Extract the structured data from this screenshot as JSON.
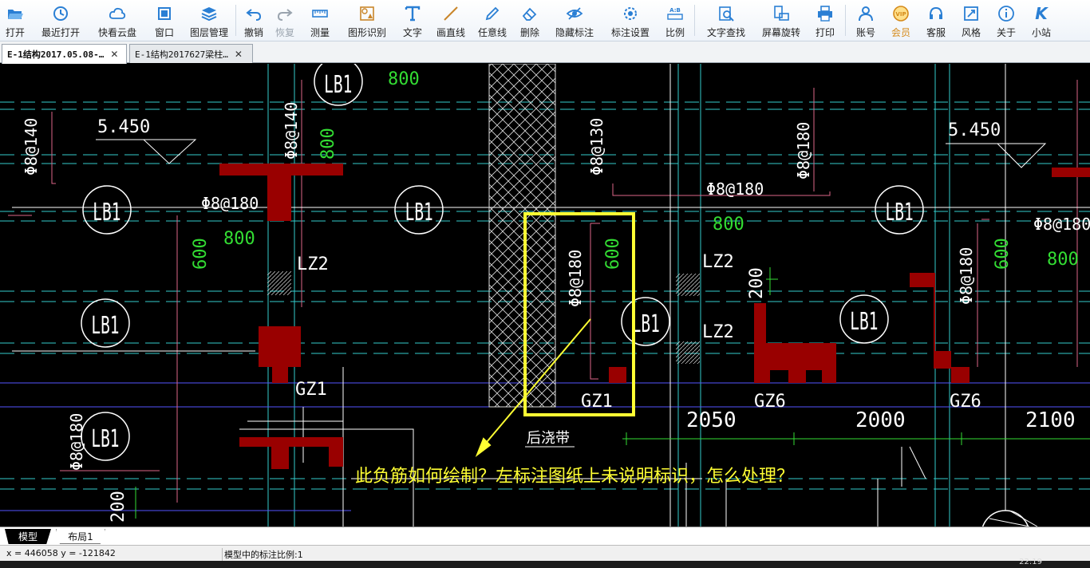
{
  "toolbar": {
    "groups": [
      [
        {
          "label": "打开",
          "icon": "folder-open-icon",
          "color": "#2a7fd4"
        },
        {
          "label": "最近打开",
          "icon": "history-icon",
          "color": "#2a7fd4"
        },
        {
          "label": "快看云盘",
          "icon": "cloud-icon",
          "color": "#2a7fd4"
        },
        {
          "label": "窗口",
          "icon": "window-icon",
          "color": "#2a7fd4"
        },
        {
          "label": "图层管理",
          "icon": "layers-icon",
          "color": "#2a7fd4"
        }
      ],
      [
        {
          "label": "撤销",
          "icon": "undo-icon",
          "color": "#2a7fd4"
        },
        {
          "label": "恢复",
          "icon": "redo-icon",
          "color": "#9aa4ae",
          "disabled": true
        },
        {
          "label": "测量",
          "icon": "ruler-icon",
          "color": "#2a7fd4"
        },
        {
          "label": "图形识别",
          "icon": "shape-recognize-icon",
          "color": "#c9862a"
        },
        {
          "label": "文字",
          "icon": "text-icon",
          "color": "#2a7fd4"
        },
        {
          "label": "画直线",
          "icon": "line-icon",
          "color": "#c9862a"
        },
        {
          "label": "任意线",
          "icon": "pen-icon",
          "color": "#2a7fd4"
        },
        {
          "label": "删除",
          "icon": "eraser-icon",
          "color": "#2a7fd4"
        },
        {
          "label": "隐藏标注",
          "icon": "eye-hide-icon",
          "color": "#2a7fd4"
        },
        {
          "label": "标注设置",
          "icon": "annotation-settings-icon",
          "color": "#2a7fd4"
        },
        {
          "label": "比例",
          "icon": "scale-icon",
          "color": "#2a7fd4"
        }
      ],
      [
        {
          "label": "文字查找",
          "icon": "text-search-icon",
          "color": "#2a7fd4"
        },
        {
          "label": "屏幕旋转",
          "icon": "screen-rotate-icon",
          "color": "#2a7fd4"
        },
        {
          "label": "打印",
          "icon": "printer-icon",
          "color": "#2a7fd4"
        }
      ],
      [
        {
          "label": "账号",
          "icon": "user-icon",
          "color": "#2a7fd4"
        },
        {
          "label": "会员",
          "icon": "vip-icon",
          "color": "#d58a1a",
          "vip": true
        },
        {
          "label": "客服",
          "icon": "headset-icon",
          "color": "#2a7fd4"
        },
        {
          "label": "风格",
          "icon": "style-icon",
          "color": "#2a7fd4"
        },
        {
          "label": "关于",
          "icon": "info-icon",
          "color": "#2a7fd4"
        },
        {
          "label": "小站",
          "icon": "site-k-icon",
          "color": "#2a7fd4"
        }
      ]
    ],
    "vip_badge": "VIP",
    "scale_badge": "A:B",
    "site_letter": "K"
  },
  "tabs": [
    {
      "label": "E-1结构2017.05.08-…",
      "close": "✕",
      "active": true
    },
    {
      "label": "E-1结构2017627梁柱…",
      "close": "✕",
      "active": false
    }
  ],
  "drawing": {
    "labels_lb1": [
      "LB1",
      "LB1",
      "LB1",
      "LB1",
      "LB1",
      "LB1",
      "LB1",
      "LB1",
      "LB1"
    ],
    "elev_left": "5.450",
    "elev_right": "5.450",
    "rebar": {
      "phi8_140": "Φ8@140",
      "phi8_180": "Φ8@180",
      "phi8_130": "Φ8@130"
    },
    "dims_green": {
      "d800": "800",
      "d600": "600",
      "d200": "200"
    },
    "marks": {
      "lz2": "LZ2",
      "gz1": "GZ1",
      "gz6": "GZ6",
      "post_pour": "后浇带"
    },
    "dims_white": {
      "d2050": "2050",
      "d2000": "2000",
      "d2100": "2100",
      "d200": "200"
    },
    "question": "此负筋如何绘制？左标注图纸上未说明标识，怎么处理？"
  },
  "layout_tabs": [
    {
      "label": "模型",
      "active": true
    },
    {
      "label": "布局1",
      "active": false
    }
  ],
  "status": {
    "coord": "x = 446058  y = -121842",
    "scale": "模型中的标注比例:1",
    "clock": "22:19"
  },
  "colors": {
    "toolbar_bg": "#eef3f9",
    "canvas_bg": "#000000",
    "cad_white": "#ffffff",
    "cad_green": "#33dd33",
    "cad_cyan": "#33cccc",
    "cad_red": "#990000",
    "cad_pink": "#dd6688",
    "cad_blue": "#5555ff",
    "highlight_yellow": "#ffff33"
  }
}
